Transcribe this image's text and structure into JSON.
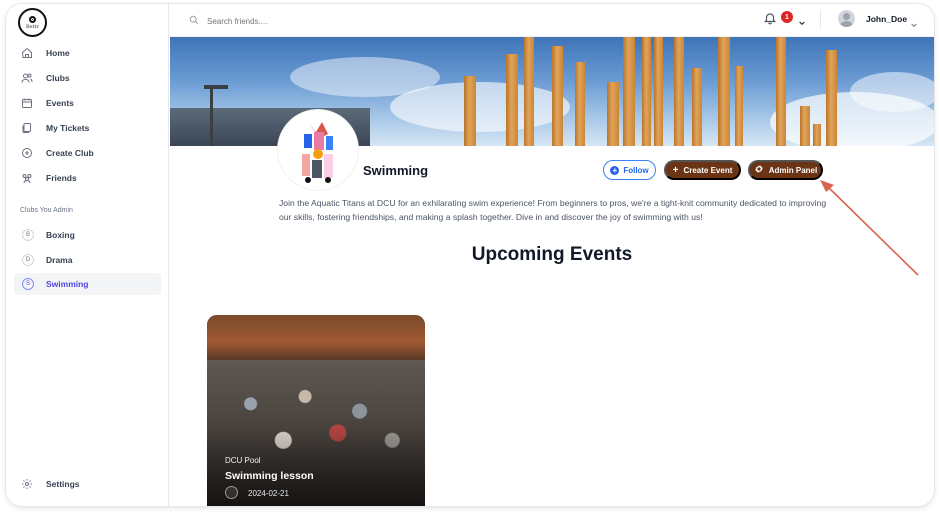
{
  "app": {
    "brand": "Bettr"
  },
  "sidebar": {
    "nav": [
      {
        "label": "Home",
        "icon": "home-icon"
      },
      {
        "label": "Clubs",
        "icon": "users-icon"
      },
      {
        "label": "Events",
        "icon": "calendar-icon"
      },
      {
        "label": "My Tickets",
        "icon": "ticket-icon"
      },
      {
        "label": "Create Club",
        "icon": "plus-circle-icon"
      },
      {
        "label": "Friends",
        "icon": "friends-icon"
      }
    ],
    "admin_section_label": "Clubs You Admin",
    "admin_clubs": [
      {
        "initial": "B",
        "label": "Boxing"
      },
      {
        "initial": "D",
        "label": "Drama"
      },
      {
        "initial": "S",
        "label": "Swimming",
        "active": true
      }
    ],
    "settings_label": "Settings"
  },
  "topbar": {
    "search_placeholder": "Search friends....",
    "notification_count": "1",
    "username": "John_Doe"
  },
  "club": {
    "name": "Swimming",
    "follow_label": "Follow",
    "create_event_label": "Create Event",
    "admin_panel_label": "Admin Panel",
    "description": "Join the Aquatic Titans at DCU for an exhilarating swim experience! From beginners to pros, we're a tight-knit community dedicated to improving our skills, fostering friendships, and making a splash together. Dive in and discover the joy of swimming with us!"
  },
  "events": {
    "heading": "Upcoming Events",
    "items": [
      {
        "location": "DCU Pool",
        "title": "Swimming lesson",
        "date": "2024-02-21"
      }
    ]
  },
  "colors": {
    "primary_brown": "#6b3515",
    "accent_blue": "#2563eb",
    "active_purple": "#4f46e5",
    "notification_red": "#dc2626",
    "annotation_arrow": "#d9634f"
  }
}
